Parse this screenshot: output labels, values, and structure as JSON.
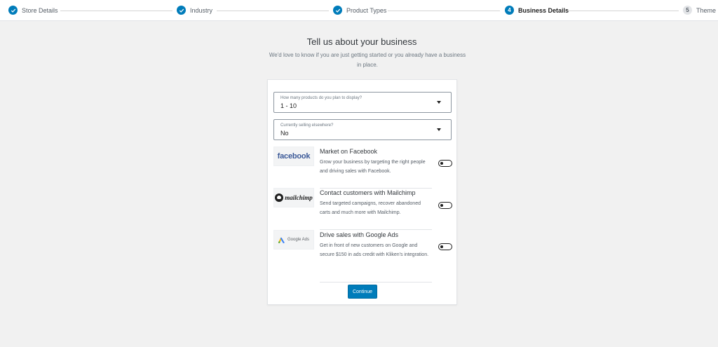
{
  "stepper": {
    "steps": [
      {
        "label": "Store Details",
        "status": "done"
      },
      {
        "label": "Industry",
        "status": "done"
      },
      {
        "label": "Product Types",
        "status": "done"
      },
      {
        "label": "Business Details",
        "status": "current",
        "number": "4"
      },
      {
        "label": "Theme",
        "status": "todo",
        "number": "5"
      }
    ]
  },
  "header": {
    "title": "Tell us about your business",
    "subtitle": "We'd love to know if you are just getting started or you already have a business in place."
  },
  "form": {
    "products_select": {
      "label": "How many products do you plan to display?",
      "value": "1 - 10"
    },
    "selling_select": {
      "label": "Currently selling elsewhere?",
      "value": "No"
    },
    "extensions": [
      {
        "logo_text": "facebook",
        "icon": "facebook-logo",
        "title": "Market on Facebook",
        "description": "Grow your business by targeting the right people and driving sales with Facebook.",
        "enabled": false
      },
      {
        "logo_text": "mailchimp",
        "icon": "mailchimp-logo",
        "title": "Contact customers with Mailchimp",
        "description": "Send targeted campaigns, recover abandoned carts and much more with Mailchimp.",
        "enabled": false
      },
      {
        "logo_text": "Google Ads",
        "icon": "google-ads-logo",
        "title": "Drive sales with Google Ads",
        "description": "Get in front of new customers on Google and secure $150 in ads credit with Kliken's integration.",
        "enabled": false
      }
    ],
    "continue_label": "Continue"
  },
  "colors": {
    "accent": "#007cba",
    "background": "#f1f1f1",
    "facebook": "#3b5998"
  }
}
